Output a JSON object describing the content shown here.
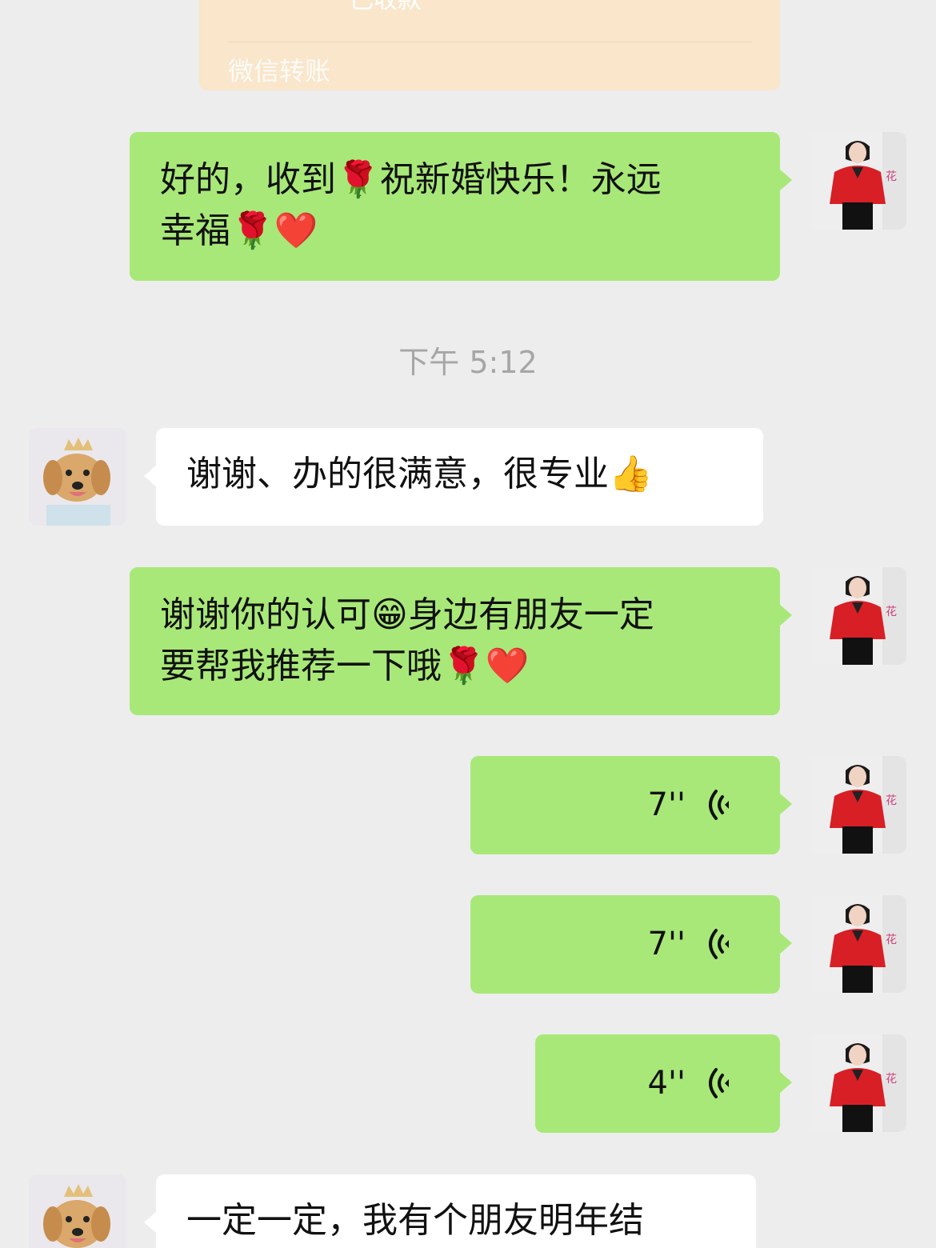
{
  "transfer_card": {
    "status": "已收款",
    "label": "微信转账"
  },
  "timestamp": "下午 5:12",
  "messages": {
    "m1": {
      "line1": "好的，收到🌹祝新婚快乐！永远",
      "line2": "幸福🌹❤️"
    },
    "m2": {
      "line1": "谢谢、办的很满意，很专业👍"
    },
    "m3": {
      "line1": "谢谢你的认可😁身边有朋友一定",
      "line2": "要帮我推荐一下哦🌹❤️"
    },
    "v1": {
      "duration": "7''"
    },
    "v2": {
      "duration": "7''"
    },
    "v3": {
      "duration": "4''"
    },
    "m4": {
      "line1": "一定一定，我有个朋友明年结"
    }
  },
  "colors": {
    "background": "#ededed",
    "outgoing_bubble": "#a8e878",
    "incoming_bubble": "#ffffff",
    "transfer_card": "#f9e6cb"
  },
  "icons": {
    "self_avatar": "woman-in-red-blouse-avatar",
    "other_avatar": "golden-retriever-with-crown-avatar",
    "voice": "voice-wave-icon"
  }
}
